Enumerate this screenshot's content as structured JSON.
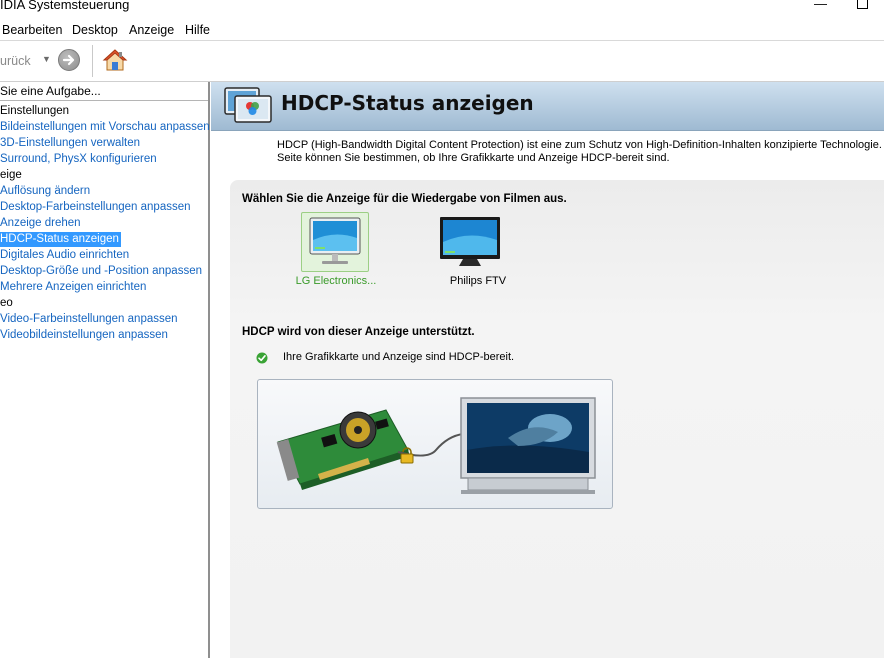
{
  "window": {
    "title": "IDIA Systemsteuerung",
    "minimize_glyph": "—"
  },
  "menu": {
    "items": [
      "Bearbeiten",
      "Desktop",
      "Anzeige",
      "Hilfe"
    ]
  },
  "toolbar": {
    "back_label": "urück",
    "dropdown_glyph": "▼",
    "icons": [
      "back-dropdown-icon",
      "forward-arrow-icon",
      "home-icon"
    ]
  },
  "sidebar": {
    "header": "Sie eine Aufgabe...",
    "items": [
      {
        "label": "Einstellungen",
        "kind": "category"
      },
      {
        "label": "Bildeinstellungen mit Vorschau anpassen",
        "kind": "link"
      },
      {
        "label": "3D-Einstellungen verwalten",
        "kind": "link"
      },
      {
        "label": "Surround, PhysX konfigurieren",
        "kind": "link"
      },
      {
        "label": "eige",
        "kind": "category"
      },
      {
        "label": "Auflösung ändern",
        "kind": "link"
      },
      {
        "label": "Desktop-Farbeinstellungen anpassen",
        "kind": "link"
      },
      {
        "label": "Anzeige drehen",
        "kind": "link"
      },
      {
        "label": "HDCP-Status anzeigen",
        "kind": "selected"
      },
      {
        "label": "Digitales Audio einrichten",
        "kind": "link"
      },
      {
        "label": "Desktop-Größe und -Position anpassen",
        "kind": "link"
      },
      {
        "label": "Mehrere Anzeigen einrichten",
        "kind": "link"
      },
      {
        "label": "eo",
        "kind": "category"
      },
      {
        "label": "Video-Farbeinstellungen anpassen",
        "kind": "link"
      },
      {
        "label": "Videobildeinstellungen anpassen",
        "kind": "link"
      }
    ]
  },
  "page": {
    "title": "HDCP-Status anzeigen",
    "description_line1": "HDCP (High-Bandwidth Digital Content Protection) ist eine zum Schutz von High-Definition-Inhalten konzipierte Technologie. Auf d",
    "description_line2": "Seite können Sie bestimmen, ob Ihre Grafikkarte und Anzeige HDCP-bereit sind.",
    "select_heading": "Wählen Sie die Anzeige für die Wiedergabe von Filmen aus.",
    "displays": [
      {
        "name": "LG Electronics...",
        "selected": true
      },
      {
        "name": "Philips FTV",
        "selected": false
      }
    ],
    "support_heading": "HDCP wird von dieser Anzeige unterstützt.",
    "status_text": "Ihre Grafikkarte und Anzeige sind HDCP-bereit."
  },
  "colors": {
    "link": "#1565c0",
    "selection": "#3399ff",
    "selected_display_text": "#3a9b2a",
    "banner_top": "#cfe0ef",
    "banner_bottom": "#9fbad2"
  }
}
